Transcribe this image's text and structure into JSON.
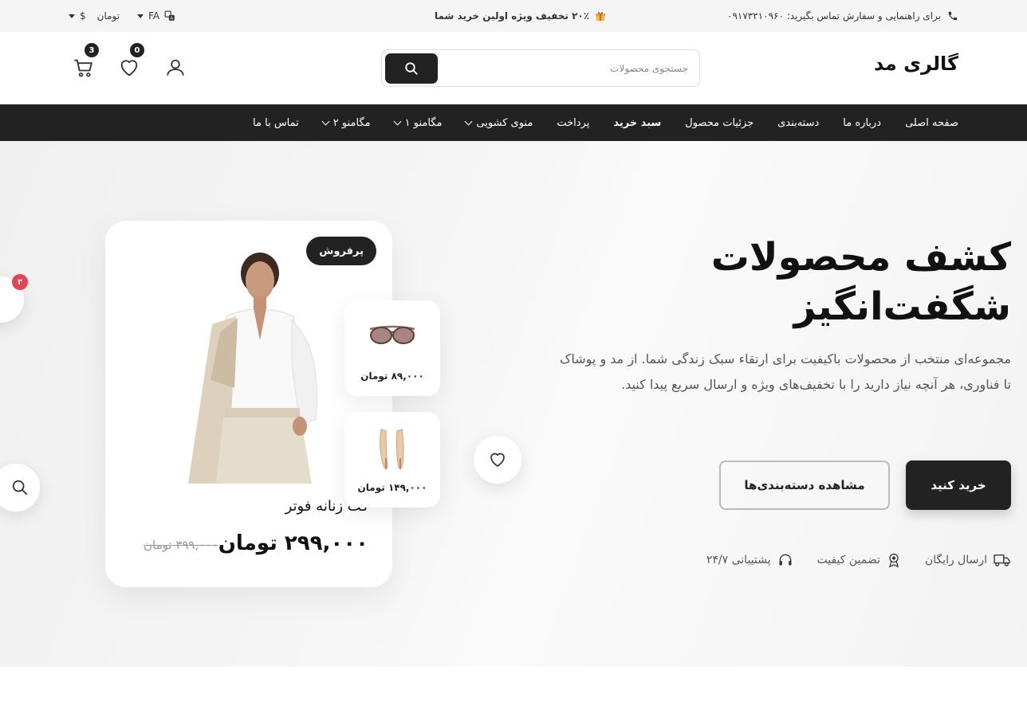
{
  "topbar": {
    "contact_text": "برای راهنمایی و سفارش تماس بگیرید: ۰۹۱۷۳۲۱۰۹۶۰",
    "promo_text": "۲۰٪ تخفیف ویژه اولین خرید شما",
    "language": "FA",
    "currency_symbol": "$",
    "currency": "تومان"
  },
  "header": {
    "logo": "گالری مد",
    "search_placeholder": "جستجوی محصولات",
    "wishlist_count": "0",
    "cart_count": "3"
  },
  "nav": {
    "items": [
      {
        "label": "صفحه اصلی"
      },
      {
        "label": "درباره ما"
      },
      {
        "label": "دسته‌بندی"
      },
      {
        "label": "جزئیات محصول"
      },
      {
        "label": "سبد خرید"
      },
      {
        "label": "پرداخت"
      },
      {
        "label": "منوی کشویی"
      },
      {
        "label": "مگامنو ۱"
      },
      {
        "label": "مگامنو ۲"
      },
      {
        "label": "تماس با ما"
      }
    ]
  },
  "hero": {
    "title_line1": "کشف محصولات",
    "title_line2": "شگفت‌انگیز",
    "description": "مجموعه‌ای منتخب از محصولات باکیفیت برای ارتقاء سبک زندگی شما. از مد و پوشاک تا فناوری، هر آنچه نیاز دارید را با تخفیف‌های ویژه و ارسال سریع پیدا کنید.",
    "primary_button": "خرید کنید",
    "secondary_button": "مشاهده دسته‌بندی‌ها",
    "features": [
      {
        "label": "ارسال رایگان",
        "icon": "truck-icon"
      },
      {
        "label": "تضمین کیفیت",
        "icon": "award-icon"
      },
      {
        "label": "پشتیبانی ۲۴/۷",
        "icon": "headset-icon"
      }
    ]
  },
  "product_card": {
    "tag": "پرفروش",
    "name": "کت زنانه فوتر",
    "price": "۲۹۹,۰۰۰ تومان",
    "old_price": "۳۹۹,۰۰۰ تومان"
  },
  "mini_products": [
    {
      "price": "۸۹,۰۰۰ تومان",
      "icon": "sunglasses-icon"
    },
    {
      "price": "۱۴۹,۰۰۰ تومان",
      "icon": "heels-icon"
    }
  ],
  "floating_cart_count": "۳",
  "colors": {
    "accent": "#222222",
    "badge_red": "#e8414f",
    "topbar_bg": "#f5f5f5"
  }
}
